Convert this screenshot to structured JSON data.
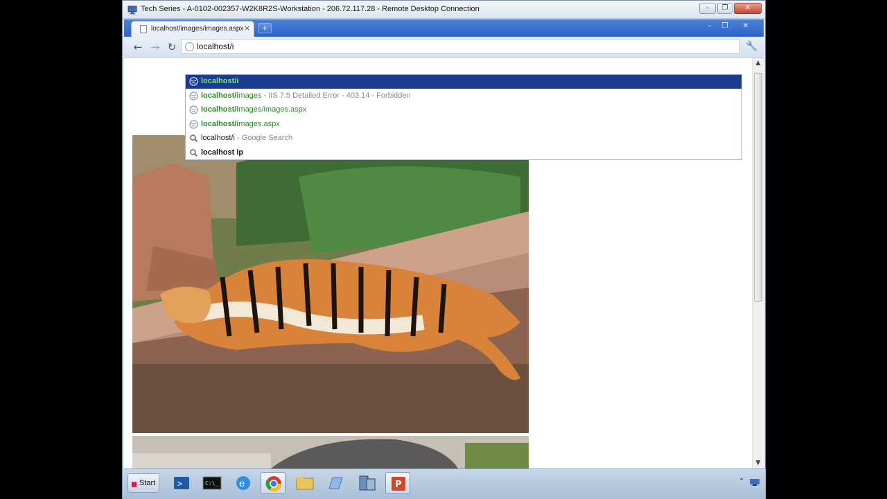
{
  "rdp": {
    "title": "Tech Series - A-0102-002357-W2K8R2S-Workstation - 206.72.117.28 - Remote Desktop Connection",
    "controls": {
      "minimize": "–",
      "restore": "❐",
      "close": "✕"
    }
  },
  "browser": {
    "tab": {
      "label": "localhost/images/images.aspx",
      "close": "×"
    },
    "new_tab": "+",
    "window_controls": {
      "minimize": "–",
      "restore": "❐",
      "close": "✕"
    },
    "nav": {
      "back": "←",
      "forward": "→",
      "reload": "↻"
    },
    "address": {
      "value": "localhost/i"
    },
    "wrench": "🔧"
  },
  "autocomplete": [
    {
      "type": "url",
      "match": "localhost/i",
      "rest": "",
      "desc": "",
      "selected": true
    },
    {
      "type": "url",
      "match": "localhost/i",
      "rest": "mages",
      "desc": " - IIS 7.5 Detailed Error - 403.14 - Forbidden",
      "selected": false
    },
    {
      "type": "url",
      "match": "localhost/i",
      "rest": "mages/images.aspx",
      "desc": "",
      "selected": false
    },
    {
      "type": "url",
      "match": "localhost/i",
      "rest": "mages.aspx",
      "desc": "",
      "selected": false
    },
    {
      "type": "search",
      "match": "localhost/i",
      "rest": "",
      "desc": " - Google Search",
      "selected": false
    },
    {
      "type": "search",
      "match": "localhost ip",
      "rest": "",
      "desc": "",
      "selected": false
    }
  ],
  "scrollbar": {
    "up": "▲",
    "down": "▼"
  },
  "taskbar": {
    "start_label": "Start",
    "apps": [
      "powershell-icon",
      "command-prompt-icon",
      "internet-explorer-icon",
      "chrome-icon",
      "file-explorer-icon",
      "notepad-icon",
      "server-manager-icon",
      "powerpoint-icon"
    ],
    "tray": "⌃"
  },
  "colors": {
    "selection": "#1a3d8f",
    "url_green": "#2c8a2c",
    "chrome_frame": "#2f62c6"
  }
}
